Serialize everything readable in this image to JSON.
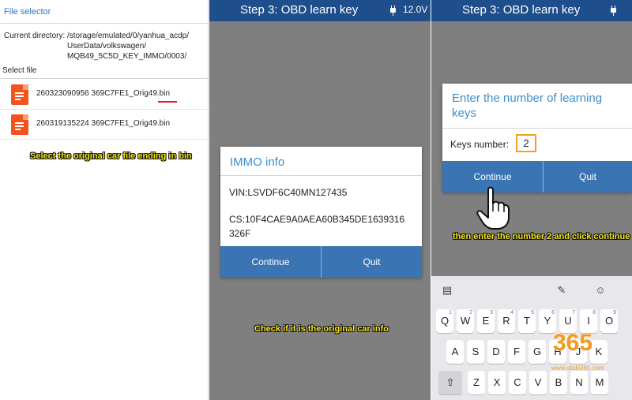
{
  "panel1": {
    "title": "File selector",
    "current_label": "Current directory:",
    "path_lines": [
      "/storage/emulated/0/yanhua_acdp/",
      "UserData/volkswagen/",
      "MQB49_5C5D_KEY_IMMO/0003/"
    ],
    "select_label": "Select file",
    "files": [
      {
        "name": "260323090956 369C7FE1_Orig49.bin",
        "icon": "document-icon"
      },
      {
        "name": "260319135224 369C7FE1_Orig49.bin",
        "icon": "document-icon"
      }
    ],
    "caption": "Select the original car file ending in bin"
  },
  "panel2": {
    "header_title": "Step 3: OBD learn key",
    "voltage": "12.0V",
    "dialog": {
      "title": "IMMO info",
      "vin": "VIN:LSVDF6C40MN127435",
      "cs_line1": "CS:10F4CAE9A0AEA60B345DE1639316",
      "cs_line2": "326F",
      "continue": "Continue",
      "quit": "Quit"
    },
    "caption": "Check if it is the original car info"
  },
  "panel3": {
    "header_title": "Step 3: OBD learn key",
    "dialog": {
      "title_line1": "Enter the number of learning",
      "title_line2": "keys",
      "label": "Keys number:",
      "value": "2",
      "continue": "Continue",
      "quit": "Quit"
    },
    "caption": "then enter the number 2 and click continue",
    "keyboard": {
      "row1": [
        {
          "k": "Q",
          "n": "1"
        },
        {
          "k": "W",
          "n": "2"
        },
        {
          "k": "E",
          "n": "3"
        },
        {
          "k": "R",
          "n": "4"
        },
        {
          "k": "T",
          "n": "5"
        },
        {
          "k": "Y",
          "n": "6"
        },
        {
          "k": "U",
          "n": "7"
        },
        {
          "k": "I",
          "n": "8"
        },
        {
          "k": "O",
          "n": "9"
        }
      ],
      "row2": [
        "A",
        "S",
        "D",
        "F",
        "G",
        "H",
        "J",
        "K"
      ],
      "row3": [
        "Z",
        "X",
        "C",
        "V",
        "B",
        "N",
        "M"
      ]
    },
    "watermark": {
      "num": "365",
      "url": "www.obdii365.com"
    }
  },
  "colors": {
    "header": "#1f4e8c",
    "button": "#3b74b3",
    "title": "#3c8ed0",
    "caption": "#f5e41a",
    "file_icon": "#f1541d"
  }
}
